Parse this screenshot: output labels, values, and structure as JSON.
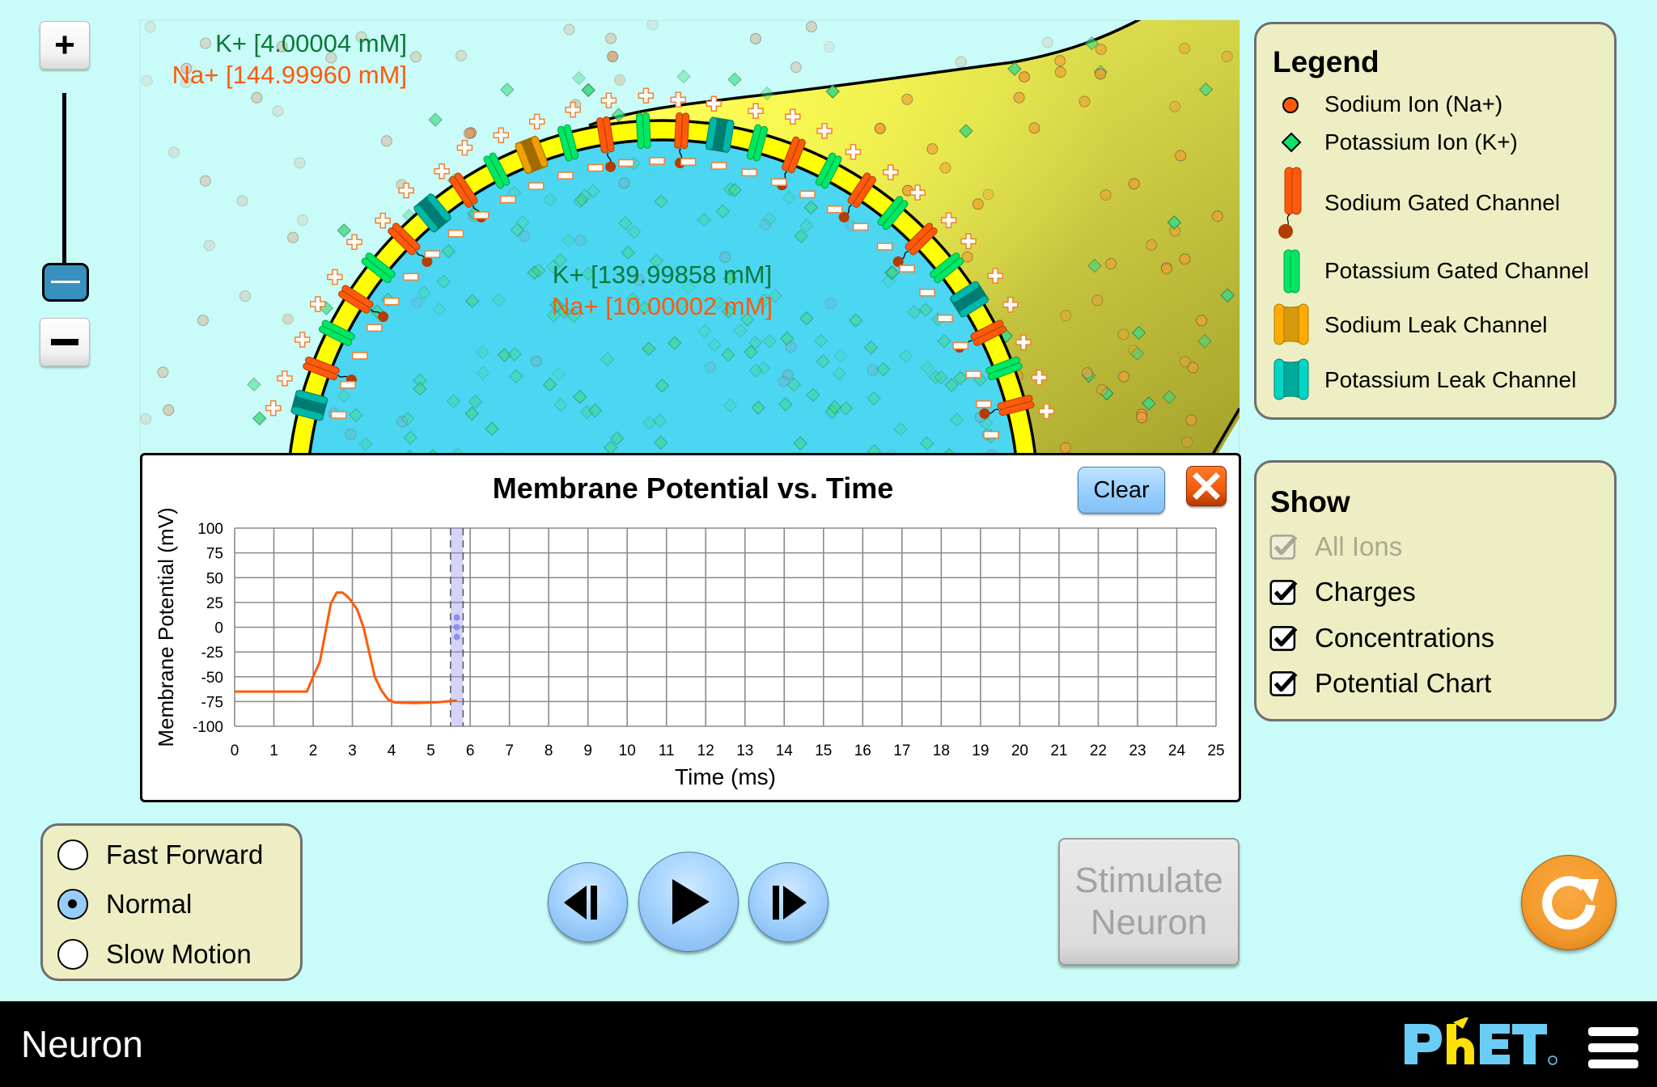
{
  "app": {
    "title": "Neuron"
  },
  "concentrations": {
    "exterior": {
      "k": "K+ [4.00004 mM]",
      "na": "Na+ [144.99960 mM]"
    },
    "interior": {
      "k": "K+ [139.99858 mM]",
      "na": "Na+ [10.00002 mM]"
    }
  },
  "zoom": {
    "in_label": "+",
    "out_label": "−",
    "level_fraction": 0.0
  },
  "legend": {
    "title": "Legend",
    "items": [
      {
        "label": "Sodium Ion (Na+)",
        "icon": "sodium-ion-icon",
        "color": "#ff5a0a"
      },
      {
        "label": "Potassium Ion (K+)",
        "icon": "potassium-ion-icon",
        "color": "#11e06b"
      },
      {
        "label": "Sodium Gated Channel",
        "icon": "sodium-gated-channel-icon",
        "color": "#ff5a0a"
      },
      {
        "label": "Potassium Gated Channel",
        "icon": "potassium-gated-channel-icon",
        "color": "#00e862"
      },
      {
        "label": "Sodium Leak Channel",
        "icon": "sodium-leak-channel-icon",
        "color": "#ffa800"
      },
      {
        "label": "Potassium Leak Channel",
        "icon": "potassium-leak-channel-icon",
        "color": "#00d6c3"
      }
    ]
  },
  "show": {
    "title": "Show",
    "options": [
      {
        "label": "All Ions",
        "checked": true,
        "enabled": false
      },
      {
        "label": "Charges",
        "checked": true,
        "enabled": true
      },
      {
        "label": "Concentrations",
        "checked": true,
        "enabled": true
      },
      {
        "label": "Potential Chart",
        "checked": true,
        "enabled": true
      }
    ]
  },
  "chart_panel": {
    "clear_label": "Clear",
    "close_icon": "close-icon"
  },
  "chart_data": {
    "type": "line",
    "title": "Membrane Potential vs. Time",
    "xlabel": "Time (ms)",
    "ylabel": "Membrane Potential (mV)",
    "xlim": [
      0,
      25
    ],
    "ylim": [
      -100,
      100
    ],
    "xticks": [
      0,
      1,
      2,
      3,
      4,
      5,
      6,
      7,
      8,
      9,
      10,
      11,
      12,
      13,
      14,
      15,
      16,
      17,
      18,
      19,
      20,
      21,
      22,
      23,
      24,
      25
    ],
    "yticks": [
      100,
      75,
      50,
      25,
      0,
      -25,
      -50,
      -75,
      -100
    ],
    "grid": true,
    "series": [
      {
        "name": "Membrane Potential",
        "color": "#ff5a0a",
        "x": [
          0,
          1.84,
          2.0,
          2.17,
          2.45,
          2.6,
          2.74,
          2.85,
          2.96,
          3.12,
          3.29,
          3.57,
          3.74,
          3.91,
          4.08,
          4.6,
          5.15,
          5.66
        ],
        "y": [
          -65,
          -65,
          -50,
          -35,
          24,
          35,
          35,
          32,
          27,
          18,
          -1,
          -50,
          -64,
          -73,
          -76,
          -76.5,
          -75.8,
          -74
        ]
      }
    ],
    "time_cursor": {
      "x": 5.66,
      "width_ms": 0.32
    }
  },
  "speed": {
    "options": [
      {
        "label": "Fast Forward",
        "selected": false
      },
      {
        "label": "Normal",
        "selected": true
      },
      {
        "label": "Slow Motion",
        "selected": false
      }
    ]
  },
  "playback": {
    "step_back": "step-back-icon",
    "play": "play-icon",
    "step_forward": "step-forward-icon"
  },
  "stimulate": {
    "line1": "Stimulate",
    "line2": "Neuron",
    "enabled": false
  },
  "navbar": {
    "brand": "PhET"
  }
}
